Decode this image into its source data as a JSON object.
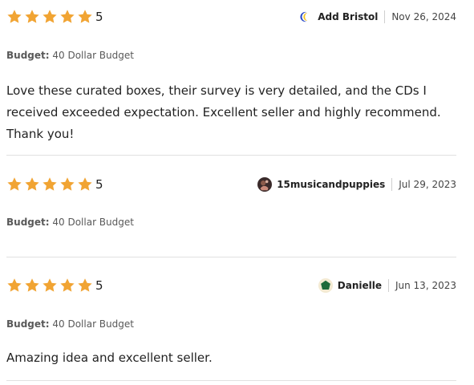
{
  "star_color": "#F1A433",
  "reviews": [
    {
      "rating": 5,
      "rating_label": "5",
      "reviewer": "Add Bristol",
      "avatar_icon": "moon-avatar-icon",
      "date": "Nov 26, 2024",
      "budget_label": "Budget:",
      "budget_value": "40 Dollar Budget",
      "text": "Love these curated boxes, their survey is very detailed, and the CDs I received exceeded expectation. Excellent seller and highly recommend. Thank you!"
    },
    {
      "rating": 5,
      "rating_label": "5",
      "reviewer": "15musicandpuppies",
      "avatar_icon": "photo-avatar-icon",
      "date": "Jul 29, 2023",
      "budget_label": "Budget:",
      "budget_value": "40 Dollar Budget",
      "text": ""
    },
    {
      "rating": 5,
      "rating_label": "5",
      "reviewer": "Danielle",
      "avatar_icon": "pentagon-avatar-icon",
      "date": "Jun 13, 2023",
      "budget_label": "Budget:",
      "budget_value": "40 Dollar Budget",
      "text": "Amazing idea and excellent seller."
    }
  ]
}
